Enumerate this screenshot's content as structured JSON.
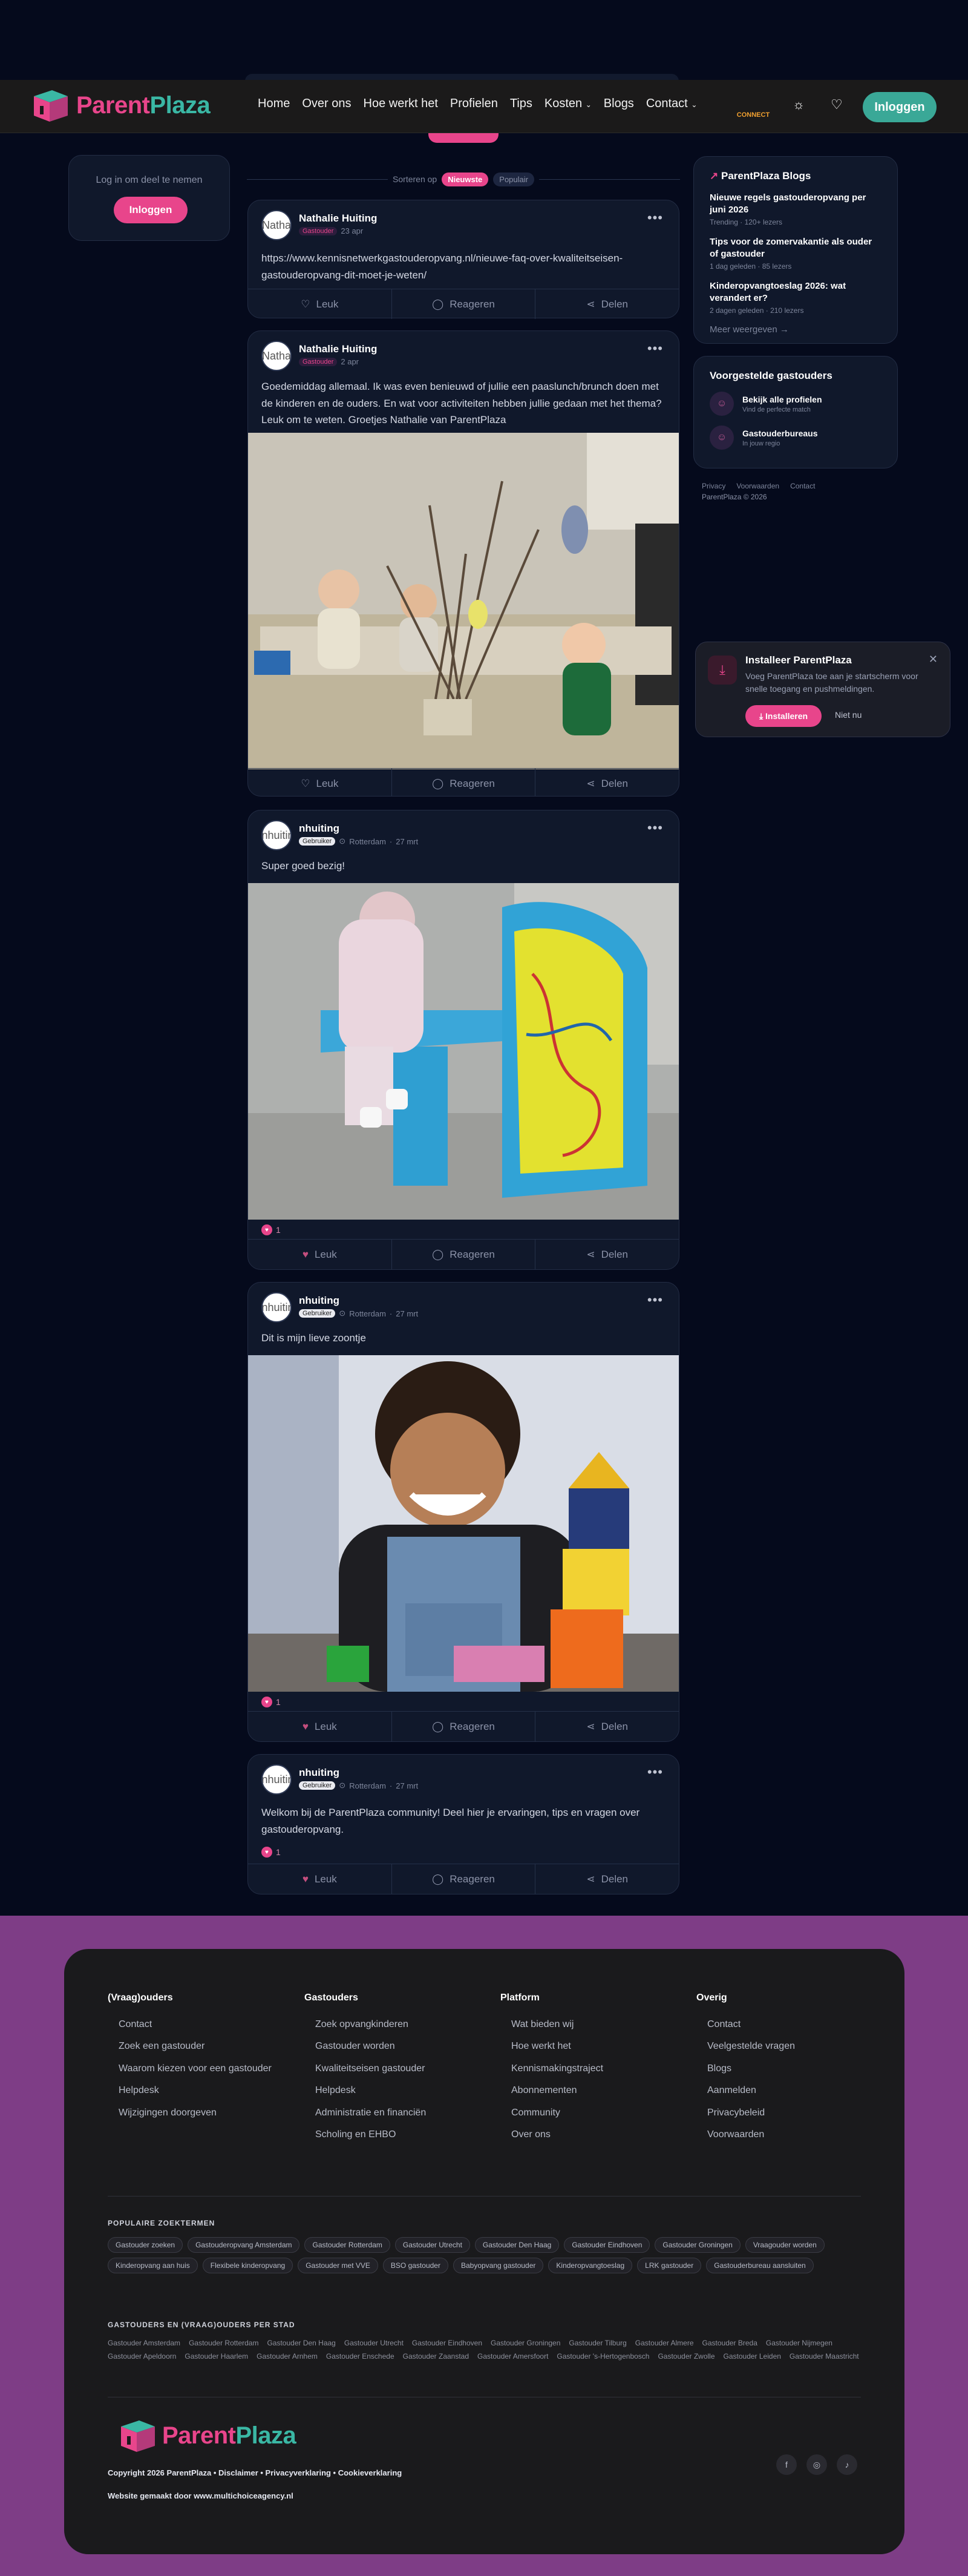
{
  "brand": {
    "part1": "Parent",
    "part2": "Plaza"
  },
  "nav": {
    "items": [
      "Home",
      "Over ons",
      "Hoe werkt het",
      "Profielen",
      "Tips",
      "Kosten",
      "Blogs",
      "Contact"
    ],
    "connect": "CONNECT",
    "login": "Inloggen"
  },
  "left": {
    "text": "Log in om deel te nemen",
    "button": "Inloggen"
  },
  "sort": {
    "label": "Sorteren op",
    "newest": "Nieuwste",
    "popular": "Populair"
  },
  "actions": {
    "like": "Leuk",
    "reply": "Reageren",
    "share": "Delen"
  },
  "posts": [
    {
      "author": "Nathalie Huiting",
      "avatar": "Natha",
      "role": "Gastouder",
      "time": "23 apr",
      "text": "https://www.kennisnetwerkgastouderopvang.nl/nieuwe-faq-over-kwaliteitseisen-gastouderopvang-dit-moet-je-weten/",
      "likes": ""
    },
    {
      "author": "Nathalie Huiting",
      "avatar": "Natha",
      "role": "Gastouder",
      "time": "2 apr",
      "text": "Goedemiddag allemaal. Ik was even benieuwd of jullie een paaslunch/brunch doen met de kinderen en de ouders. En wat voor activiteiten hebben jullie gedaan met het thema? Leuk om te weten. Groetjes Nathalie van ParentPlaza",
      "likes": ""
    },
    {
      "author": "nhuiting",
      "avatar": "nhuitir",
      "role": "Gebruiker",
      "location": "Rotterdam",
      "time": "27 mrt",
      "text": "Super goed bezig!",
      "likes": "1"
    },
    {
      "author": "nhuiting",
      "avatar": "nhuitir",
      "role": "Gebruiker",
      "location": "Rotterdam",
      "time": "27 mrt",
      "text": "Dit is mijn lieve zoontje",
      "likes": "1"
    },
    {
      "author": "nhuiting",
      "avatar": "nhuitir",
      "role": "Gebruiker",
      "location": "Rotterdam",
      "time": "27 mrt",
      "text": "Welkom bij de ParentPlaza community! Deel hier je ervaringen, tips en vragen over gastouderopvang.",
      "likes": "1"
    }
  ],
  "blogs": {
    "title": "ParentPlaza Blogs",
    "items": [
      {
        "title": "Nieuwe regels gastouderopvang per juni 2026",
        "meta": "Trending · 120+ lezers"
      },
      {
        "title": "Tips voor de zomervakantie als ouder of gastouder",
        "meta": "1 dag geleden · 85 lezers"
      },
      {
        "title": "Kinderopvangtoeslag 2026: wat verandert er?",
        "meta": "2 dagen geleden · 210 lezers"
      }
    ],
    "more": "Meer weergeven →"
  },
  "suggested": {
    "title": "Voorgestelde gastouders",
    "items": [
      {
        "title": "Bekijk alle profielen",
        "meta": "Vind de perfecte match"
      },
      {
        "title": "Gastouderbureaus",
        "meta": "In jouw regio"
      }
    ]
  },
  "side_links": [
    "Privacy",
    "Voorwaarden",
    "Contact"
  ],
  "side_copy": "ParentPlaza © 2026",
  "install": {
    "title": "Installeer ParentPlaza",
    "desc": "Voeg ParentPlaza toe aan je startscherm voor snelle toegang en pushmeldingen.",
    "primary": "Installeren",
    "secondary": "Niet nu"
  },
  "footer": {
    "cols": [
      {
        "title": "(Vraag)ouders",
        "links": [
          "Contact",
          "Zoek een gastouder",
          "Waarom kiezen voor een gastouder",
          "Helpdesk",
          "Wijzigingen doorgeven"
        ]
      },
      {
        "title": "Gastouders",
        "links": [
          "Zoek opvangkinderen",
          "Gastouder worden",
          "Kwaliteitseisen gastouder",
          "Helpdesk",
          "Administratie en financiën",
          "Scholing en EHBO"
        ]
      },
      {
        "title": "Platform",
        "links": [
          "Wat bieden wij",
          "Hoe werkt het",
          "Kennismakingstraject",
          "Abonnementen",
          "Community",
          "Over ons"
        ]
      },
      {
        "title": "Overig",
        "links": [
          "Contact",
          "Veelgestelde vragen",
          "Blogs",
          "Aanmelden",
          "Privacybeleid",
          "Voorwaarden"
        ]
      }
    ],
    "popular_title": "POPULAIRE ZOEKTERMEN",
    "popular": [
      "Gastouder zoeken",
      "Gastouderopvang Amsterdam",
      "Gastouder Rotterdam",
      "Gastouder Utrecht",
      "Gastouder Den Haag",
      "Gastouder Eindhoven",
      "Gastouder Groningen",
      "Vraagouder worden",
      "Kinderopvang aan huis",
      "Flexibele kinderopvang",
      "Gastouder met VVE",
      "BSO gastouder",
      "Babyopvang gastouder",
      "Kinderopvangtoeslag",
      "LRK gastouder",
      "Gastouderbureau aansluiten"
    ],
    "cities_title": "GASTOUDERS EN (VRAAG)OUDERS PER STAD",
    "cities": [
      "Gastouder Amsterdam",
      "Gastouder Rotterdam",
      "Gastouder Den Haag",
      "Gastouder Utrecht",
      "Gastouder Eindhoven",
      "Gastouder Groningen",
      "Gastouder Tilburg",
      "Gastouder Almere",
      "Gastouder Breda",
      "Gastouder Nijmegen",
      "Gastouder Apeldoorn",
      "Gastouder Haarlem",
      "Gastouder Arnhem",
      "Gastouder Enschede",
      "Gastouder Zaanstad",
      "Gastouder Amersfoort",
      "Gastouder 's-Hertogenbosch",
      "Gastouder Zwolle",
      "Gastouder Leiden",
      "Gastouder Maastricht"
    ],
    "copyright": "Copyright 2026 ParentPlaza • Disclaimer • Privacyverklaring • Cookieverklaring",
    "madeby": "Website gemaakt door www.multichoiceagency.nl"
  }
}
